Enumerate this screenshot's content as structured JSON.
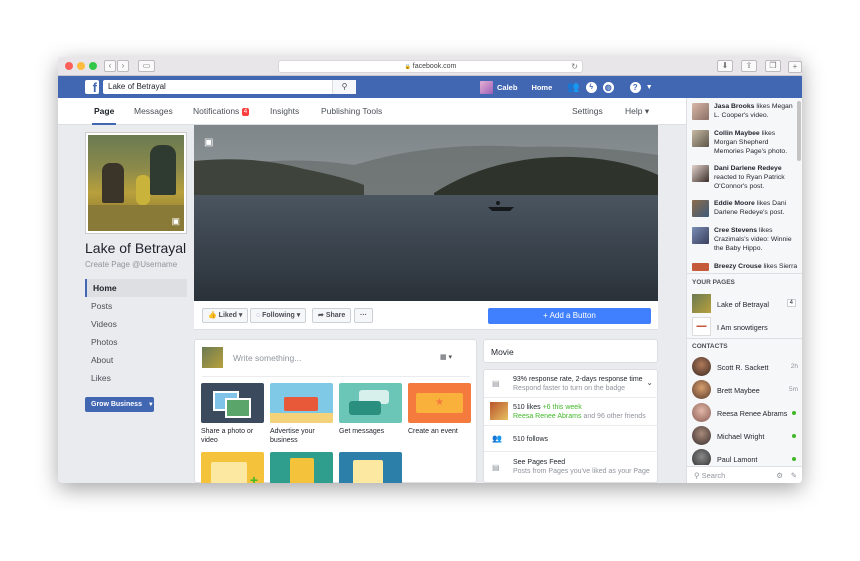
{
  "browser": {
    "url": "facebook.com",
    "lock": "🔒",
    "reload_icon": "↻"
  },
  "fb": {
    "search_value": "Lake of Betrayal",
    "user": "Caleb",
    "home": "Home"
  },
  "tabs": {
    "page": "Page",
    "messages": "Messages",
    "notifications": "Notifications",
    "notif_count": "4",
    "insights": "Insights",
    "publishing": "Publishing Tools",
    "settings": "Settings",
    "help": "Help ▾"
  },
  "page": {
    "name": "Lake of Betrayal",
    "username": "Create Page @Username"
  },
  "left_nav": [
    "Home",
    "Posts",
    "Videos",
    "Photos",
    "About",
    "Likes"
  ],
  "grow_button": "Grow Business",
  "actions": {
    "liked": "Liked",
    "following": "Following",
    "share": "Share",
    "more": "···",
    "add_button": "+ Add a Button"
  },
  "composer": {
    "placeholder": "Write something...",
    "cards": [
      {
        "label": "Share a photo or video"
      },
      {
        "label": "Advertise your business"
      },
      {
        "label": "Get messages"
      },
      {
        "label": "Create an event"
      }
    ]
  },
  "movie": "Movie",
  "stats": {
    "response": "93% response rate, 2-days response time",
    "response_sub": "Respond faster to turn on the badge",
    "likes": "510 likes",
    "likes_week": "+6 this week",
    "likes_friends_name": "Reesa Renee Abrams",
    "likes_friends": "and 96 other friends",
    "follows": "510 follows",
    "feed": "See Pages Feed",
    "feed_sub": "Posts from Pages you've liked as your Page"
  },
  "ticker": [
    {
      "name": "Jasa Brooks",
      "text": "likes Megan L. Cooper's video."
    },
    {
      "name": "Collin Maybee",
      "text": "likes Morgan Shepherd Memories Page's photo."
    },
    {
      "name": "Dani Darlene Redeye",
      "text": "reacted to Ryan Patrick O'Connor's post."
    },
    {
      "name": "Eddie Moore",
      "text": "likes Dani Darlene Redeye's post."
    },
    {
      "name": "Cree Stevens",
      "text": "likes Crazimals's video: Winnie the Baby Hippo."
    },
    {
      "name": "Breezy Crouse",
      "text": "likes Sierra"
    }
  ],
  "your_pages": {
    "title": "YOUR PAGES",
    "items": [
      {
        "name": "Lake of Betrayal",
        "count": "4"
      },
      {
        "name": "I Am snowtigers"
      }
    ]
  },
  "contacts": {
    "title": "CONTACTS",
    "items": [
      {
        "name": "Scott R. Sackett",
        "meta": "2h"
      },
      {
        "name": "Brett Maybee",
        "meta": "5m"
      },
      {
        "name": "Reesa Renee Abrams",
        "meta": ""
      },
      {
        "name": "Michael Wright",
        "meta": ""
      },
      {
        "name": "Paul Lamont",
        "meta": ""
      }
    ]
  },
  "search_placeholder": "Search",
  "colors": {
    "fb_blue": "#4267b2",
    "button_blue": "#4080ff",
    "online": "#42b72a"
  }
}
